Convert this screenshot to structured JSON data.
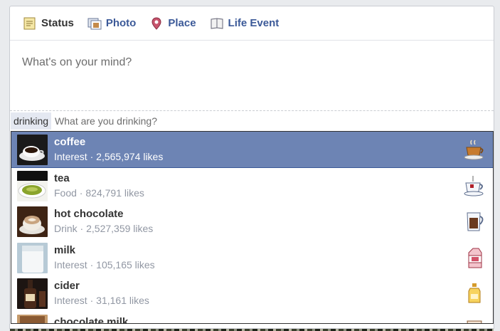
{
  "tabs": [
    {
      "label": "Status",
      "icon": "status-icon"
    },
    {
      "label": "Photo",
      "icon": "photo-icon"
    },
    {
      "label": "Place",
      "icon": "place-icon"
    },
    {
      "label": "Life Event",
      "icon": "life-event-icon"
    }
  ],
  "composer": {
    "placeholder": "What's on your mind?"
  },
  "activity": {
    "tag": "drinking",
    "placeholder": "What are you drinking?"
  },
  "suggestions": [
    {
      "name": "coffee",
      "category": "Interest",
      "likes": "2,565,974 likes",
      "icon": "coffee-cup-icon"
    },
    {
      "name": "tea",
      "category": "Food",
      "likes": "824,791 likes",
      "icon": "teacup-icon"
    },
    {
      "name": "hot chocolate",
      "category": "Drink",
      "likes": "2,527,359 likes",
      "icon": "mug-icon"
    },
    {
      "name": "milk",
      "category": "Interest",
      "likes": "105,165 likes",
      "icon": "milk-carton-icon"
    },
    {
      "name": "cider",
      "category": "Interest",
      "likes": "31,161 likes",
      "icon": "bottle-icon"
    },
    {
      "name": "chocolate milk",
      "category": "",
      "likes": "",
      "icon": "drink-icon"
    }
  ],
  "colors": {
    "link": "#3b5998",
    "selected": "#6d84b4",
    "meta": "#9197a3"
  }
}
